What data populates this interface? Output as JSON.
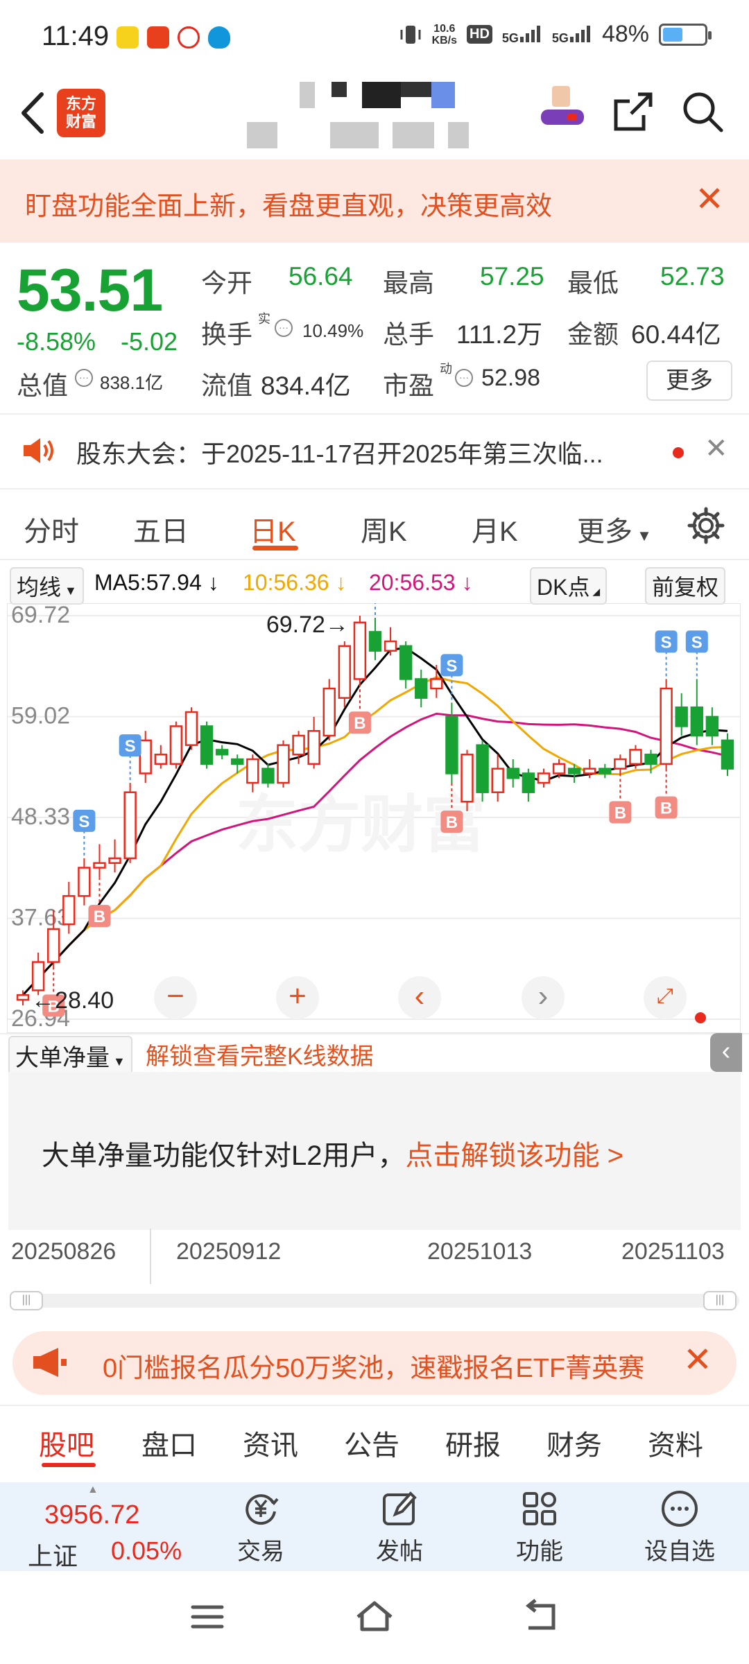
{
  "status_bar": {
    "time": "11:49",
    "net_speed_value": "10.6",
    "net_speed_unit": "KB/s",
    "hd_label": "HD",
    "signal_1": "5G",
    "signal_2": "5G",
    "battery": "48%",
    "battery_level": 0.48
  },
  "nav": {
    "logo_line1": "东方",
    "logo_line2": "财富"
  },
  "banner": {
    "text": "盯盘功能全面上新，看盘更直观，决策更高效"
  },
  "quote": {
    "price": "53.51",
    "change_pct": "-8.58%",
    "change": "-5.02",
    "open_label": "今开",
    "open": "56.64",
    "high_label": "最高",
    "high": "57.25",
    "low_label": "最低",
    "low": "52.73",
    "turnover_label": "换手",
    "turnover_sup": "实",
    "turnover": "10.49%",
    "volume_label": "总手",
    "volume": "111.2万",
    "amount_label": "金额",
    "amount": "60.44亿",
    "mktcap_label": "总值",
    "mktcap": "838.1亿",
    "float_label": "流值",
    "float_cap": "834.4亿",
    "pe_label": "市盈",
    "pe_sup": "动",
    "pe": "52.98",
    "more": "更多"
  },
  "notice": {
    "text": "股东大会：于2025-11-17召开2025年第三次临..."
  },
  "k_tabs": [
    {
      "label": "分时"
    },
    {
      "label": "五日"
    },
    {
      "label": "日K"
    },
    {
      "label": "周K"
    },
    {
      "label": "月K"
    },
    {
      "label": "更多"
    }
  ],
  "ma_row": {
    "selector": "均线",
    "ma5": "MA5:57.94 ↓",
    "ma10": "10:56.36 ↓",
    "ma20": "20:56.53 ↓",
    "dk": "DK点",
    "adjust": "前复权"
  },
  "chart_data": {
    "type": "candlestick",
    "y_ticks": [
      "69.72",
      "59.02",
      "48.33",
      "37.63",
      "26.94"
    ],
    "ylim": [
      26.94,
      69.72
    ],
    "max_label": "69.72",
    "min_label": "28.40",
    "dates": [
      "20250826",
      "20250912",
      "20251013",
      "20251103"
    ],
    "watermark": "东方财富",
    "signals": [
      "S",
      "B"
    ],
    "candles": [
      {
        "o": 29.0,
        "c": 29.5,
        "h": 30.0,
        "l": 28.4
      },
      {
        "o": 30.0,
        "c": 33.0,
        "h": 34.0,
        "l": 29.5
      },
      {
        "o": 33.0,
        "c": 36.5,
        "h": 38.5,
        "l": 32.5
      },
      {
        "o": 37.0,
        "c": 40.0,
        "h": 41.5,
        "l": 36.0
      },
      {
        "o": 40.0,
        "c": 43.0,
        "h": 44.0,
        "l": 39.0
      },
      {
        "o": 43.0,
        "c": 43.5,
        "h": 45.5,
        "l": 42.0
      },
      {
        "o": 43.5,
        "c": 44.0,
        "h": 46.0,
        "l": 42.5
      },
      {
        "o": 44.0,
        "c": 51.0,
        "h": 52.0,
        "l": 43.5
      },
      {
        "o": 53.0,
        "c": 56.5,
        "h": 57.5,
        "l": 52.0
      },
      {
        "o": 54.0,
        "c": 55.0,
        "h": 56.0,
        "l": 53.5
      },
      {
        "o": 54.0,
        "c": 58.0,
        "h": 58.5,
        "l": 53.5
      },
      {
        "o": 56.0,
        "c": 59.5,
        "h": 60.0,
        "l": 55.5
      },
      {
        "o": 58.0,
        "c": 54.0,
        "h": 58.5,
        "l": 53.5
      },
      {
        "o": 55.5,
        "c": 55.0,
        "h": 56.0,
        "l": 54.5
      },
      {
        "o": 54.5,
        "c": 54.0,
        "h": 55.0,
        "l": 53.0
      },
      {
        "o": 52.0,
        "c": 54.5,
        "h": 55.0,
        "l": 51.0
      },
      {
        "o": 53.5,
        "c": 52.0,
        "h": 54.0,
        "l": 51.5
      },
      {
        "o": 52.0,
        "c": 56.0,
        "h": 56.5,
        "l": 51.5
      },
      {
        "o": 55.0,
        "c": 57.0,
        "h": 57.5,
        "l": 54.0
      },
      {
        "o": 54.0,
        "c": 57.5,
        "h": 59.0,
        "l": 53.5
      },
      {
        "o": 57.0,
        "c": 62.0,
        "h": 63.0,
        "l": 56.5
      },
      {
        "o": 61.0,
        "c": 66.5,
        "h": 67.0,
        "l": 60.0
      },
      {
        "o": 63.0,
        "c": 69.0,
        "h": 69.72,
        "l": 62.5
      },
      {
        "o": 68.0,
        "c": 66.0,
        "h": 69.5,
        "l": 65.0
      },
      {
        "o": 66.0,
        "c": 67.0,
        "h": 68.5,
        "l": 65.5
      },
      {
        "o": 66.5,
        "c": 63.0,
        "h": 67.0,
        "l": 62.0
      },
      {
        "o": 63.0,
        "c": 61.0,
        "h": 64.0,
        "l": 60.0
      },
      {
        "o": 62.0,
        "c": 63.0,
        "h": 64.5,
        "l": 61.0
      },
      {
        "o": 59.0,
        "c": 53.0,
        "h": 60.5,
        "l": 52.0
      },
      {
        "o": 50.0,
        "c": 55.0,
        "h": 55.5,
        "l": 49.0
      },
      {
        "o": 56.0,
        "c": 51.0,
        "h": 56.5,
        "l": 50.0
      },
      {
        "o": 51.0,
        "c": 53.5,
        "h": 55.0,
        "l": 50.0
      },
      {
        "o": 53.5,
        "c": 52.5,
        "h": 54.5,
        "l": 51.5
      },
      {
        "o": 53.0,
        "c": 51.0,
        "h": 53.5,
        "l": 50.0
      },
      {
        "o": 52.0,
        "c": 53.0,
        "h": 53.5,
        "l": 51.5
      },
      {
        "o": 53.0,
        "c": 54.0,
        "h": 54.5,
        "l": 52.5
      },
      {
        "o": 53.5,
        "c": 53.0,
        "h": 54.0,
        "l": 52.0
      },
      {
        "o": 53.0,
        "c": 53.5,
        "h": 54.5,
        "l": 52.5
      },
      {
        "o": 53.5,
        "c": 53.0,
        "h": 54.0,
        "l": 52.5
      },
      {
        "o": 53.5,
        "c": 54.5,
        "h": 55.0,
        "l": 53.0
      },
      {
        "o": 54.0,
        "c": 55.5,
        "h": 56.0,
        "l": 53.5
      },
      {
        "o": 55.0,
        "c": 54.0,
        "h": 55.5,
        "l": 53.0
      },
      {
        "o": 54.0,
        "c": 62.0,
        "h": 63.0,
        "l": 53.5
      },
      {
        "o": 60.0,
        "c": 58.0,
        "h": 61.5,
        "l": 57.0
      },
      {
        "o": 60.0,
        "c": 57.0,
        "h": 63.0,
        "l": 56.0
      },
      {
        "o": 59.0,
        "c": 57.0,
        "h": 60.0,
        "l": 56.0
      },
      {
        "o": 56.5,
        "c": 53.5,
        "h": 57.25,
        "l": 52.73
      }
    ]
  },
  "lower": {
    "selector": "大单净量",
    "unlock_link": "解锁查看完整K线数据",
    "lock_text": "大单净量功能仅针对L2用户，",
    "lock_link": "点击解锁该功能 >"
  },
  "promo": {
    "text": "0门槛报名瓜分50万奖池，速戳报名ETF菁英赛"
  },
  "bottom_tabs": [
    {
      "label": "股吧"
    },
    {
      "label": "盘口"
    },
    {
      "label": "资讯"
    },
    {
      "label": "公告"
    },
    {
      "label": "研报"
    },
    {
      "label": "财务"
    },
    {
      "label": "资料"
    }
  ],
  "toolbar": {
    "index_value": "3956.72",
    "index_name": "上证",
    "index_change": "0.05%",
    "trade": "交易",
    "post": "发帖",
    "functions": "功能",
    "watchlist": "设自选"
  },
  "colors": {
    "up": "#e8291c",
    "down": "#19a234",
    "accent": "#e8501c",
    "ma5": "#000000",
    "ma10": "#f0a800",
    "ma20": "#d4147a"
  }
}
